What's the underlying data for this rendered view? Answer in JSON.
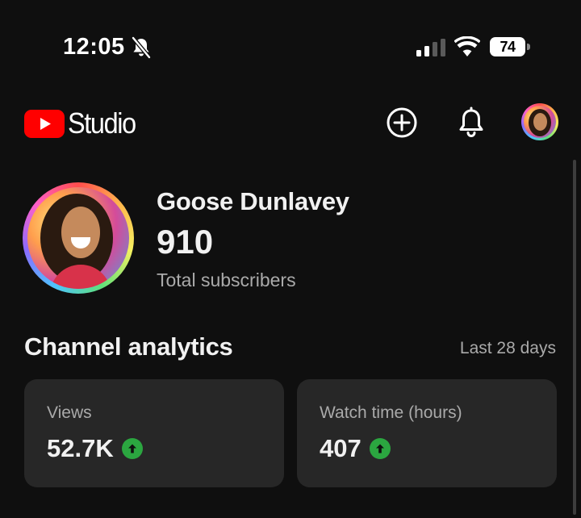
{
  "status_bar": {
    "time": "12:05",
    "battery_level": "74",
    "icons": [
      "bell-off-icon",
      "cellular-signal-icon",
      "wifi-icon",
      "battery-icon"
    ]
  },
  "header": {
    "brand": "Studio",
    "icons": [
      "youtube-logo-icon",
      "create-plus-icon",
      "notifications-bell-icon",
      "account-avatar"
    ]
  },
  "channel": {
    "name": "Goose Dunlavey",
    "subscriber_count": "910",
    "subscriber_label": "Total subscribers"
  },
  "analytics": {
    "title": "Channel analytics",
    "range": "Last 28 days",
    "metrics": [
      {
        "label": "Views",
        "value": "52.7K",
        "trend": "up"
      },
      {
        "label": "Watch time (hours)",
        "value": "407",
        "trend": "up"
      }
    ]
  },
  "colors": {
    "background": "#0f0f0f",
    "card": "#272727",
    "youtube_red": "#ff0000",
    "trend_up_green": "#2ba640",
    "secondary_text": "#aaaaaa"
  }
}
